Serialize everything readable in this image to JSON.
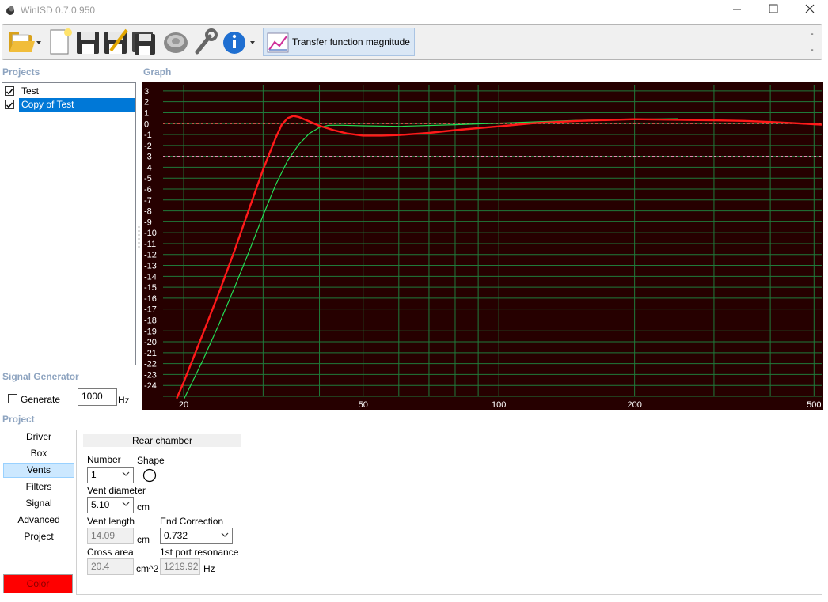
{
  "window": {
    "title": "WinISD 0.7.0.950"
  },
  "toolbar": {
    "buttons": [
      {
        "icon": "open-folder-icon"
      },
      {
        "icon": "new-project-icon"
      },
      {
        "icon": "save-icon"
      },
      {
        "icon": "save-as-icon"
      },
      {
        "icon": "save-all-icon"
      },
      {
        "icon": "driver-icon"
      },
      {
        "icon": "wrench-icon"
      },
      {
        "icon": "info-icon"
      }
    ],
    "graph_select_label": "Transfer function magnitude",
    "overflow_top": "-",
    "overflow_bottom": "-"
  },
  "projects": {
    "heading": "Projects",
    "items": [
      {
        "label": "Test",
        "checked": true,
        "selected": false
      },
      {
        "label": "Copy of Test",
        "checked": true,
        "selected": true
      }
    ]
  },
  "graph": {
    "heading": "Graph"
  },
  "chart_data": {
    "type": "line",
    "xscale": "log",
    "xlim": [
      18,
      520
    ],
    "ylim": [
      -25,
      3.5
    ],
    "x_ticks": [
      20,
      50,
      100,
      200,
      500
    ],
    "y_ticks": [
      3,
      2,
      1,
      0,
      -1,
      -2,
      -3,
      -4,
      -5,
      -6,
      -7,
      -8,
      -9,
      -10,
      -11,
      -12,
      -13,
      -14,
      -15,
      -16,
      -17,
      -18,
      -19,
      -20,
      -21,
      -22,
      -23,
      -24
    ],
    "reference_lines": [
      0,
      -3
    ],
    "grid": true,
    "series": [
      {
        "color": "#ff1a1a",
        "x": [
          19.3,
          20,
          22,
          24,
          26,
          28,
          30,
          32,
          33,
          34,
          35,
          36,
          38,
          40,
          43,
          46,
          50,
          55,
          60,
          70,
          80,
          100,
          120,
          150,
          200,
          250,
          300,
          350,
          400,
          450,
          500,
          520
        ],
        "y": [
          -25.2,
          -23.7,
          -19.4,
          -15.4,
          -11.5,
          -7.7,
          -4.2,
          -1.3,
          -0.1,
          0.5,
          0.7,
          0.6,
          0.2,
          -0.2,
          -0.6,
          -0.9,
          -1.1,
          -1.1,
          -1.05,
          -0.85,
          -0.6,
          -0.25,
          0.05,
          0.25,
          0.4,
          0.35,
          0.3,
          0.25,
          0.15,
          0.05,
          -0.05,
          -0.1
        ]
      },
      {
        "color": "#22dd55",
        "x": [
          20,
          22,
          24,
          26,
          28,
          30,
          32,
          34,
          36,
          38,
          40,
          42,
          45,
          50,
          60,
          80,
          100,
          150,
          200,
          250
        ],
        "y": [
          -25.3,
          -21.8,
          -18.3,
          -14.9,
          -11.6,
          -8.4,
          -5.6,
          -3.4,
          -1.9,
          -0.9,
          -0.35,
          -0.15,
          -0.15,
          -0.2,
          -0.25,
          -0.1,
          0.05,
          0.3,
          0.4,
          0.45
        ]
      }
    ]
  },
  "signal_generator": {
    "heading": "Signal Generator",
    "generate_label": "Generate",
    "generate_checked": false,
    "frequency": "1000",
    "unit": "Hz"
  },
  "project_nav": {
    "heading": "Project",
    "items": [
      {
        "label": "Driver",
        "selected": false
      },
      {
        "label": "Box",
        "selected": false
      },
      {
        "label": "Vents",
        "selected": true
      },
      {
        "label": "Filters",
        "selected": false
      },
      {
        "label": "Signal",
        "selected": false
      },
      {
        "label": "Advanced",
        "selected": false
      },
      {
        "label": "Project",
        "selected": false
      }
    ],
    "color_button": "Color",
    "color_value": "#ff0000"
  },
  "vents": {
    "section_title": "Rear chamber",
    "number_label": "Number",
    "number_value": "1",
    "shape_label": "Shape",
    "vent_diameter_label": "Vent diameter",
    "vent_diameter_value": "5.10",
    "vent_diameter_unit": "cm",
    "vent_length_label": "Vent length",
    "vent_length_value": "14.09",
    "vent_length_unit": "cm",
    "end_correction_label": "End Correction",
    "end_correction_value": "0.732",
    "cross_area_label": "Cross area",
    "cross_area_value": "20.4",
    "cross_area_unit": "cm^2",
    "port_resonance_label": "1st port resonance",
    "port_resonance_value": "1219.92",
    "port_resonance_unit": "Hz"
  }
}
